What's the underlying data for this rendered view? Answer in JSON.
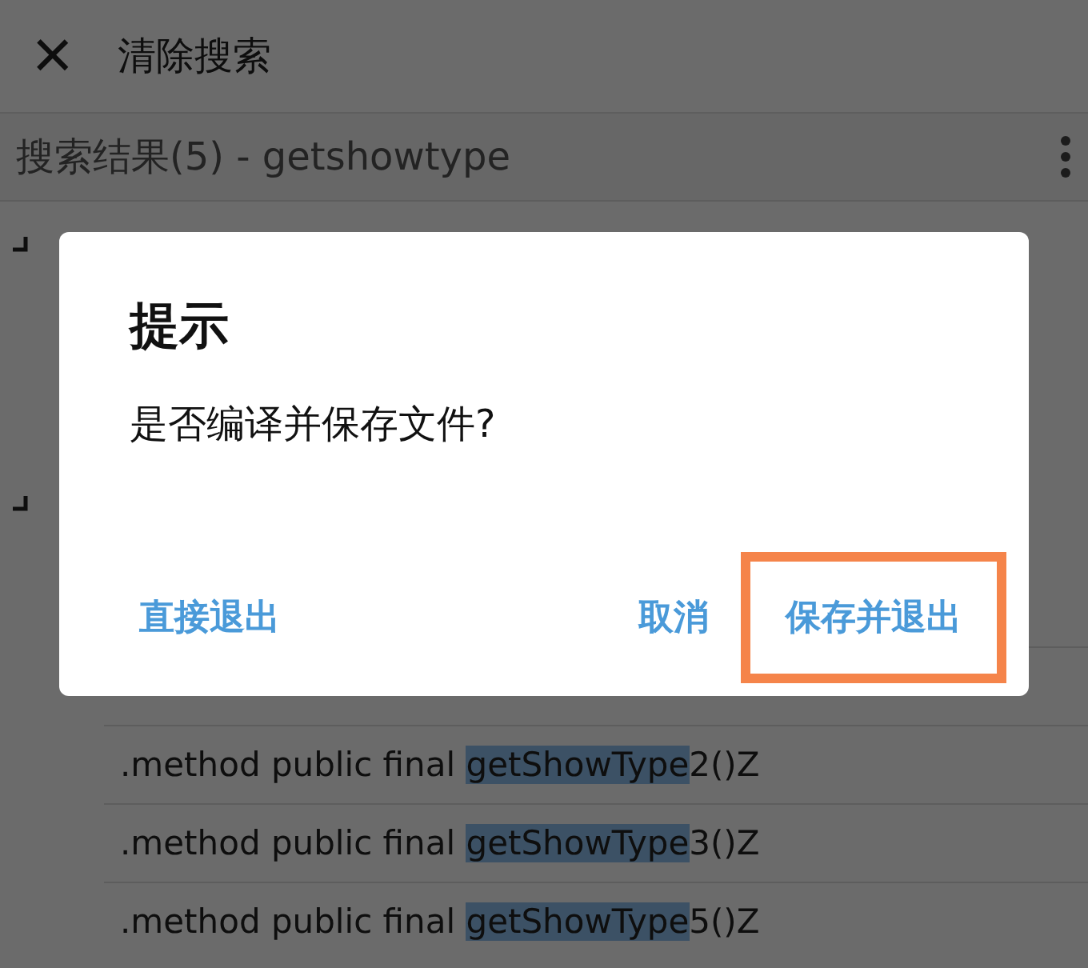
{
  "toolbar": {
    "close_icon": "×",
    "title": "清除搜索"
  },
  "results_header": {
    "title": "搜索结果(5) - getshowtype"
  },
  "methods": [
    {
      "prefix": ".method public final ",
      "match": "getShowType",
      "suffix": "2()Z"
    },
    {
      "prefix": ".method public final ",
      "match": "getShowType",
      "suffix": "3()Z"
    },
    {
      "prefix": ".method public final ",
      "match": "getShowType",
      "suffix": "5()Z"
    }
  ],
  "dialog": {
    "title": "提示",
    "message": "是否编译并保存文件?",
    "actions": [
      {
        "label": "直接退出",
        "highlighted": false
      },
      {
        "label": "取消",
        "highlighted": false
      },
      {
        "label": "保存并退出",
        "highlighted": true
      }
    ]
  }
}
